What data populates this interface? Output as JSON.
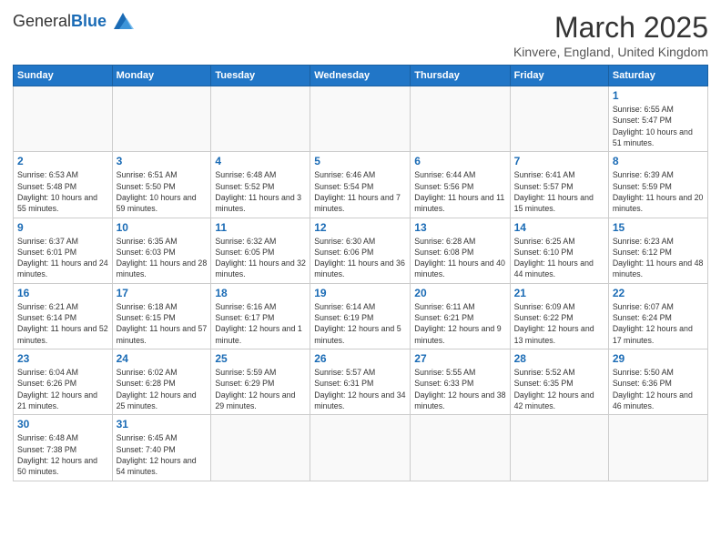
{
  "header": {
    "logo_general": "General",
    "logo_blue": "Blue",
    "month_title": "March 2025",
    "location": "Kinvere, England, United Kingdom"
  },
  "days_of_week": [
    "Sunday",
    "Monday",
    "Tuesday",
    "Wednesday",
    "Thursday",
    "Friday",
    "Saturday"
  ],
  "weeks": [
    [
      {
        "day": "",
        "info": ""
      },
      {
        "day": "",
        "info": ""
      },
      {
        "day": "",
        "info": ""
      },
      {
        "day": "",
        "info": ""
      },
      {
        "day": "",
        "info": ""
      },
      {
        "day": "",
        "info": ""
      },
      {
        "day": "1",
        "info": "Sunrise: 6:55 AM\nSunset: 5:47 PM\nDaylight: 10 hours and 51 minutes."
      }
    ],
    [
      {
        "day": "2",
        "info": "Sunrise: 6:53 AM\nSunset: 5:48 PM\nDaylight: 10 hours and 55 minutes."
      },
      {
        "day": "3",
        "info": "Sunrise: 6:51 AM\nSunset: 5:50 PM\nDaylight: 10 hours and 59 minutes."
      },
      {
        "day": "4",
        "info": "Sunrise: 6:48 AM\nSunset: 5:52 PM\nDaylight: 11 hours and 3 minutes."
      },
      {
        "day": "5",
        "info": "Sunrise: 6:46 AM\nSunset: 5:54 PM\nDaylight: 11 hours and 7 minutes."
      },
      {
        "day": "6",
        "info": "Sunrise: 6:44 AM\nSunset: 5:56 PM\nDaylight: 11 hours and 11 minutes."
      },
      {
        "day": "7",
        "info": "Sunrise: 6:41 AM\nSunset: 5:57 PM\nDaylight: 11 hours and 15 minutes."
      },
      {
        "day": "8",
        "info": "Sunrise: 6:39 AM\nSunset: 5:59 PM\nDaylight: 11 hours and 20 minutes."
      }
    ],
    [
      {
        "day": "9",
        "info": "Sunrise: 6:37 AM\nSunset: 6:01 PM\nDaylight: 11 hours and 24 minutes."
      },
      {
        "day": "10",
        "info": "Sunrise: 6:35 AM\nSunset: 6:03 PM\nDaylight: 11 hours and 28 minutes."
      },
      {
        "day": "11",
        "info": "Sunrise: 6:32 AM\nSunset: 6:05 PM\nDaylight: 11 hours and 32 minutes."
      },
      {
        "day": "12",
        "info": "Sunrise: 6:30 AM\nSunset: 6:06 PM\nDaylight: 11 hours and 36 minutes."
      },
      {
        "day": "13",
        "info": "Sunrise: 6:28 AM\nSunset: 6:08 PM\nDaylight: 11 hours and 40 minutes."
      },
      {
        "day": "14",
        "info": "Sunrise: 6:25 AM\nSunset: 6:10 PM\nDaylight: 11 hours and 44 minutes."
      },
      {
        "day": "15",
        "info": "Sunrise: 6:23 AM\nSunset: 6:12 PM\nDaylight: 11 hours and 48 minutes."
      }
    ],
    [
      {
        "day": "16",
        "info": "Sunrise: 6:21 AM\nSunset: 6:14 PM\nDaylight: 11 hours and 52 minutes."
      },
      {
        "day": "17",
        "info": "Sunrise: 6:18 AM\nSunset: 6:15 PM\nDaylight: 11 hours and 57 minutes."
      },
      {
        "day": "18",
        "info": "Sunrise: 6:16 AM\nSunset: 6:17 PM\nDaylight: 12 hours and 1 minute."
      },
      {
        "day": "19",
        "info": "Sunrise: 6:14 AM\nSunset: 6:19 PM\nDaylight: 12 hours and 5 minutes."
      },
      {
        "day": "20",
        "info": "Sunrise: 6:11 AM\nSunset: 6:21 PM\nDaylight: 12 hours and 9 minutes."
      },
      {
        "day": "21",
        "info": "Sunrise: 6:09 AM\nSunset: 6:22 PM\nDaylight: 12 hours and 13 minutes."
      },
      {
        "day": "22",
        "info": "Sunrise: 6:07 AM\nSunset: 6:24 PM\nDaylight: 12 hours and 17 minutes."
      }
    ],
    [
      {
        "day": "23",
        "info": "Sunrise: 6:04 AM\nSunset: 6:26 PM\nDaylight: 12 hours and 21 minutes."
      },
      {
        "day": "24",
        "info": "Sunrise: 6:02 AM\nSunset: 6:28 PM\nDaylight: 12 hours and 25 minutes."
      },
      {
        "day": "25",
        "info": "Sunrise: 5:59 AM\nSunset: 6:29 PM\nDaylight: 12 hours and 29 minutes."
      },
      {
        "day": "26",
        "info": "Sunrise: 5:57 AM\nSunset: 6:31 PM\nDaylight: 12 hours and 34 minutes."
      },
      {
        "day": "27",
        "info": "Sunrise: 5:55 AM\nSunset: 6:33 PM\nDaylight: 12 hours and 38 minutes."
      },
      {
        "day": "28",
        "info": "Sunrise: 5:52 AM\nSunset: 6:35 PM\nDaylight: 12 hours and 42 minutes."
      },
      {
        "day": "29",
        "info": "Sunrise: 5:50 AM\nSunset: 6:36 PM\nDaylight: 12 hours and 46 minutes."
      }
    ],
    [
      {
        "day": "30",
        "info": "Sunrise: 6:48 AM\nSunset: 7:38 PM\nDaylight: 12 hours and 50 minutes."
      },
      {
        "day": "31",
        "info": "Sunrise: 6:45 AM\nSunset: 7:40 PM\nDaylight: 12 hours and 54 minutes."
      },
      {
        "day": "",
        "info": ""
      },
      {
        "day": "",
        "info": ""
      },
      {
        "day": "",
        "info": ""
      },
      {
        "day": "",
        "info": ""
      },
      {
        "day": "",
        "info": ""
      }
    ]
  ]
}
